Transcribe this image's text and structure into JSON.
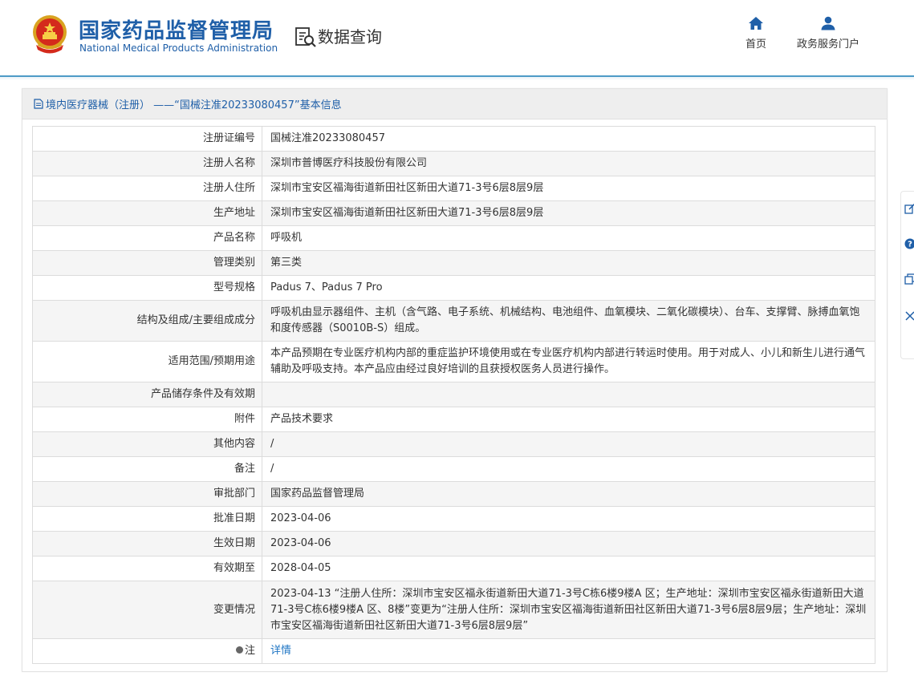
{
  "header": {
    "brand_cn": "国家药品监督管理局",
    "brand_en": "National Medical Products Administration",
    "query_title": "数据查询",
    "nav": [
      {
        "label": "首页",
        "icon": "home-icon"
      },
      {
        "label": "政务服务门户",
        "icon": "user-icon"
      }
    ]
  },
  "panel": {
    "title": "境内医疗器械（注册） ——“国械注准20233080457”基本信息"
  },
  "details": [
    {
      "label": "注册证编号",
      "value": "国械注准20233080457"
    },
    {
      "label": "注册人名称",
      "value": "深圳市普博医疗科技股份有限公司"
    },
    {
      "label": "注册人住所",
      "value": "深圳市宝安区福海街道新田社区新田大道71-3号6层8层9层"
    },
    {
      "label": "生产地址",
      "value": "深圳市宝安区福海街道新田社区新田大道71-3号6层8层9层"
    },
    {
      "label": "产品名称",
      "value": "呼吸机"
    },
    {
      "label": "管理类别",
      "value": "第三类"
    },
    {
      "label": "型号规格",
      "value": "Padus 7、Padus 7 Pro"
    },
    {
      "label": "结构及组成/主要组成成分",
      "value": "呼吸机由显示器组件、主机（含气路、电子系统、机械结构、电池组件、血氧模块、二氧化碳模块）、台车、支撑臂、脉搏血氧饱和度传感器（S0010B-S）组成。"
    },
    {
      "label": "适用范围/预期用途",
      "value": "本产品预期在专业医疗机构内部的重症监护环境使用或在专业医疗机构内部进行转运时使用。用于对成人、小儿和新生儿进行通气辅助及呼吸支持。本产品应由经过良好培训的且获授权医务人员进行操作。"
    },
    {
      "label": "产品储存条件及有效期",
      "value": ""
    },
    {
      "label": "附件",
      "value": "产品技术要求"
    },
    {
      "label": "其他内容",
      "value": "/"
    },
    {
      "label": "备注",
      "value": "/"
    },
    {
      "label": "审批部门",
      "value": "国家药品监督管理局"
    },
    {
      "label": "批准日期",
      "value": "2023-04-06"
    },
    {
      "label": "生效日期",
      "value": "2023-04-06"
    },
    {
      "label": "有效期至",
      "value": "2028-04-05"
    },
    {
      "label": "变更情况",
      "value": "2023-04-13 “注册人住所：深圳市宝安区福永街道新田大道71-3号C栋6楼9楼A 区；生产地址：深圳市宝安区福永街道新田大道71-3号C栋6楼9楼A 区、8楼”变更为“注册人住所：深圳市宝安区福海街道新田社区新田大道71-3号6层8层9层；生产地址：深圳市宝安区福海街道新田社区新田大道71-3号6层8层9层”"
    }
  ],
  "note": {
    "label": "注",
    "link": "详情"
  },
  "colors": {
    "brand_blue": "#1f5fa8",
    "link_blue": "#1f76c4",
    "header_rule": "#4e9bc7"
  }
}
